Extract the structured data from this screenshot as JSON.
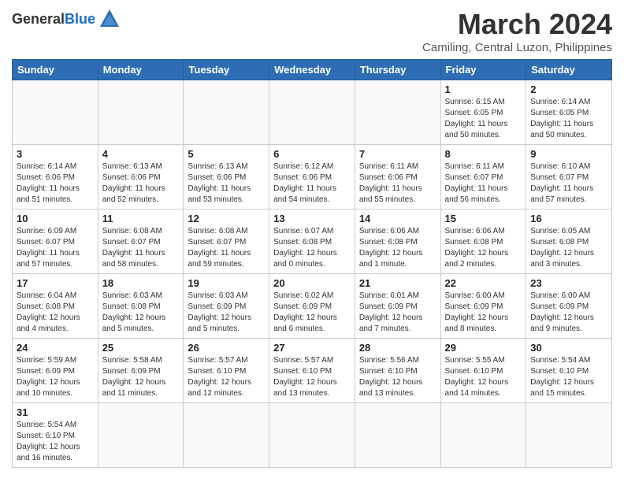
{
  "header": {
    "logo_general": "General",
    "logo_blue": "Blue",
    "month_year": "March 2024",
    "location": "Camiling, Central Luzon, Philippines"
  },
  "weekdays": [
    "Sunday",
    "Monday",
    "Tuesday",
    "Wednesday",
    "Thursday",
    "Friday",
    "Saturday"
  ],
  "weeks": [
    [
      {
        "day": "",
        "info": ""
      },
      {
        "day": "",
        "info": ""
      },
      {
        "day": "",
        "info": ""
      },
      {
        "day": "",
        "info": ""
      },
      {
        "day": "",
        "info": ""
      },
      {
        "day": "1",
        "info": "Sunrise: 6:15 AM\nSunset: 6:05 PM\nDaylight: 11 hours and 50 minutes."
      },
      {
        "day": "2",
        "info": "Sunrise: 6:14 AM\nSunset: 6:05 PM\nDaylight: 11 hours and 50 minutes."
      }
    ],
    [
      {
        "day": "3",
        "info": "Sunrise: 6:14 AM\nSunset: 6:06 PM\nDaylight: 11 hours and 51 minutes."
      },
      {
        "day": "4",
        "info": "Sunrise: 6:13 AM\nSunset: 6:06 PM\nDaylight: 11 hours and 52 minutes."
      },
      {
        "day": "5",
        "info": "Sunrise: 6:13 AM\nSunset: 6:06 PM\nDaylight: 11 hours and 53 minutes."
      },
      {
        "day": "6",
        "info": "Sunrise: 6:12 AM\nSunset: 6:06 PM\nDaylight: 11 hours and 54 minutes."
      },
      {
        "day": "7",
        "info": "Sunrise: 6:11 AM\nSunset: 6:06 PM\nDaylight: 11 hours and 55 minutes."
      },
      {
        "day": "8",
        "info": "Sunrise: 6:11 AM\nSunset: 6:07 PM\nDaylight: 11 hours and 56 minutes."
      },
      {
        "day": "9",
        "info": "Sunrise: 6:10 AM\nSunset: 6:07 PM\nDaylight: 11 hours and 57 minutes."
      }
    ],
    [
      {
        "day": "10",
        "info": "Sunrise: 6:09 AM\nSunset: 6:07 PM\nDaylight: 11 hours and 57 minutes."
      },
      {
        "day": "11",
        "info": "Sunrise: 6:08 AM\nSunset: 6:07 PM\nDaylight: 11 hours and 58 minutes."
      },
      {
        "day": "12",
        "info": "Sunrise: 6:08 AM\nSunset: 6:07 PM\nDaylight: 11 hours and 59 minutes."
      },
      {
        "day": "13",
        "info": "Sunrise: 6:07 AM\nSunset: 6:08 PM\nDaylight: 12 hours and 0 minutes."
      },
      {
        "day": "14",
        "info": "Sunrise: 6:06 AM\nSunset: 6:08 PM\nDaylight: 12 hours and 1 minute."
      },
      {
        "day": "15",
        "info": "Sunrise: 6:06 AM\nSunset: 6:08 PM\nDaylight: 12 hours and 2 minutes."
      },
      {
        "day": "16",
        "info": "Sunrise: 6:05 AM\nSunset: 6:08 PM\nDaylight: 12 hours and 3 minutes."
      }
    ],
    [
      {
        "day": "17",
        "info": "Sunrise: 6:04 AM\nSunset: 6:08 PM\nDaylight: 12 hours and 4 minutes."
      },
      {
        "day": "18",
        "info": "Sunrise: 6:03 AM\nSunset: 6:08 PM\nDaylight: 12 hours and 5 minutes."
      },
      {
        "day": "19",
        "info": "Sunrise: 6:03 AM\nSunset: 6:09 PM\nDaylight: 12 hours and 5 minutes."
      },
      {
        "day": "20",
        "info": "Sunrise: 6:02 AM\nSunset: 6:09 PM\nDaylight: 12 hours and 6 minutes."
      },
      {
        "day": "21",
        "info": "Sunrise: 6:01 AM\nSunset: 6:09 PM\nDaylight: 12 hours and 7 minutes."
      },
      {
        "day": "22",
        "info": "Sunrise: 6:00 AM\nSunset: 6:09 PM\nDaylight: 12 hours and 8 minutes."
      },
      {
        "day": "23",
        "info": "Sunrise: 6:00 AM\nSunset: 6:09 PM\nDaylight: 12 hours and 9 minutes."
      }
    ],
    [
      {
        "day": "24",
        "info": "Sunrise: 5:59 AM\nSunset: 6:09 PM\nDaylight: 12 hours and 10 minutes."
      },
      {
        "day": "25",
        "info": "Sunrise: 5:58 AM\nSunset: 6:09 PM\nDaylight: 12 hours and 11 minutes."
      },
      {
        "day": "26",
        "info": "Sunrise: 5:57 AM\nSunset: 6:10 PM\nDaylight: 12 hours and 12 minutes."
      },
      {
        "day": "27",
        "info": "Sunrise: 5:57 AM\nSunset: 6:10 PM\nDaylight: 12 hours and 13 minutes."
      },
      {
        "day": "28",
        "info": "Sunrise: 5:56 AM\nSunset: 6:10 PM\nDaylight: 12 hours and 13 minutes."
      },
      {
        "day": "29",
        "info": "Sunrise: 5:55 AM\nSunset: 6:10 PM\nDaylight: 12 hours and 14 minutes."
      },
      {
        "day": "30",
        "info": "Sunrise: 5:54 AM\nSunset: 6:10 PM\nDaylight: 12 hours and 15 minutes."
      }
    ],
    [
      {
        "day": "31",
        "info": "Sunrise: 5:54 AM\nSunset: 6:10 PM\nDaylight: 12 hours and 16 minutes."
      },
      {
        "day": "",
        "info": ""
      },
      {
        "day": "",
        "info": ""
      },
      {
        "day": "",
        "info": ""
      },
      {
        "day": "",
        "info": ""
      },
      {
        "day": "",
        "info": ""
      },
      {
        "day": "",
        "info": ""
      }
    ]
  ]
}
